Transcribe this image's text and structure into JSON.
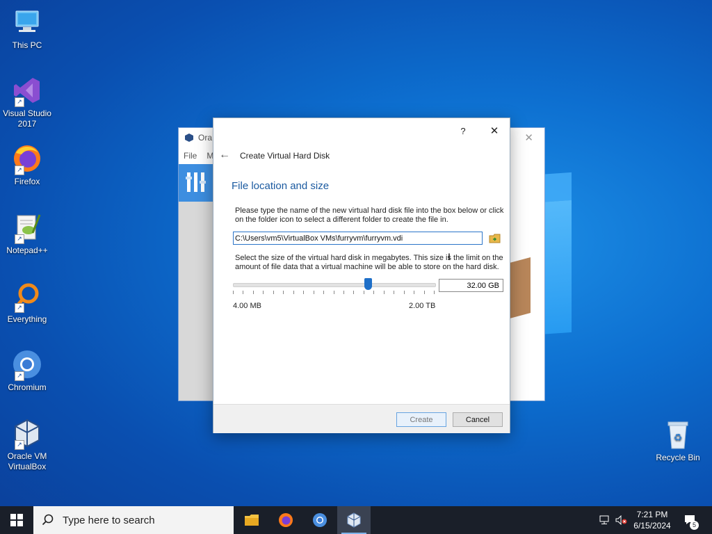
{
  "desktop": {
    "icons": [
      {
        "label": "This PC"
      },
      {
        "label": "Visual Studio 2017"
      },
      {
        "label": "Firefox"
      },
      {
        "label": "Notepad++"
      },
      {
        "label": "Everything"
      },
      {
        "label": "Chromium"
      },
      {
        "label": "Oracle VM VirtualBox"
      },
      {
        "label": "Recycle Bin"
      }
    ]
  },
  "background_window": {
    "title": "Ora",
    "menu_file": "File",
    "menu_m": "M"
  },
  "dialog": {
    "help": "?",
    "close": "✕",
    "wizard_title": "Create Virtual Hard Disk",
    "heading": "File location and size",
    "location_desc": "Please type the name of the new virtual hard disk file into the box below or click on the folder icon to select a different folder to create the file in.",
    "file_path": "C:\\Users\\vm5\\VirtualBox VMs\\furryvm\\furryvm.vdi",
    "size_desc": "Select the size of the virtual hard disk in megabytes. This size is the limit on the amount of file data that a virtual machine will be able to store on the hard disk.",
    "size_value": "32.00 GB",
    "min_label": "4.00 MB",
    "max_label": "2.00 TB",
    "slider_fraction": 0.67,
    "create_label": "Create",
    "cancel_label": "Cancel"
  },
  "taskbar": {
    "search_placeholder": "Type here to search",
    "time": "7:21 PM",
    "date": "6/15/2024",
    "notification_count": "5"
  },
  "colors": {
    "accent": "#1e6fc8",
    "heading": "#1b5aa0",
    "taskbar": "#1a1f29"
  }
}
